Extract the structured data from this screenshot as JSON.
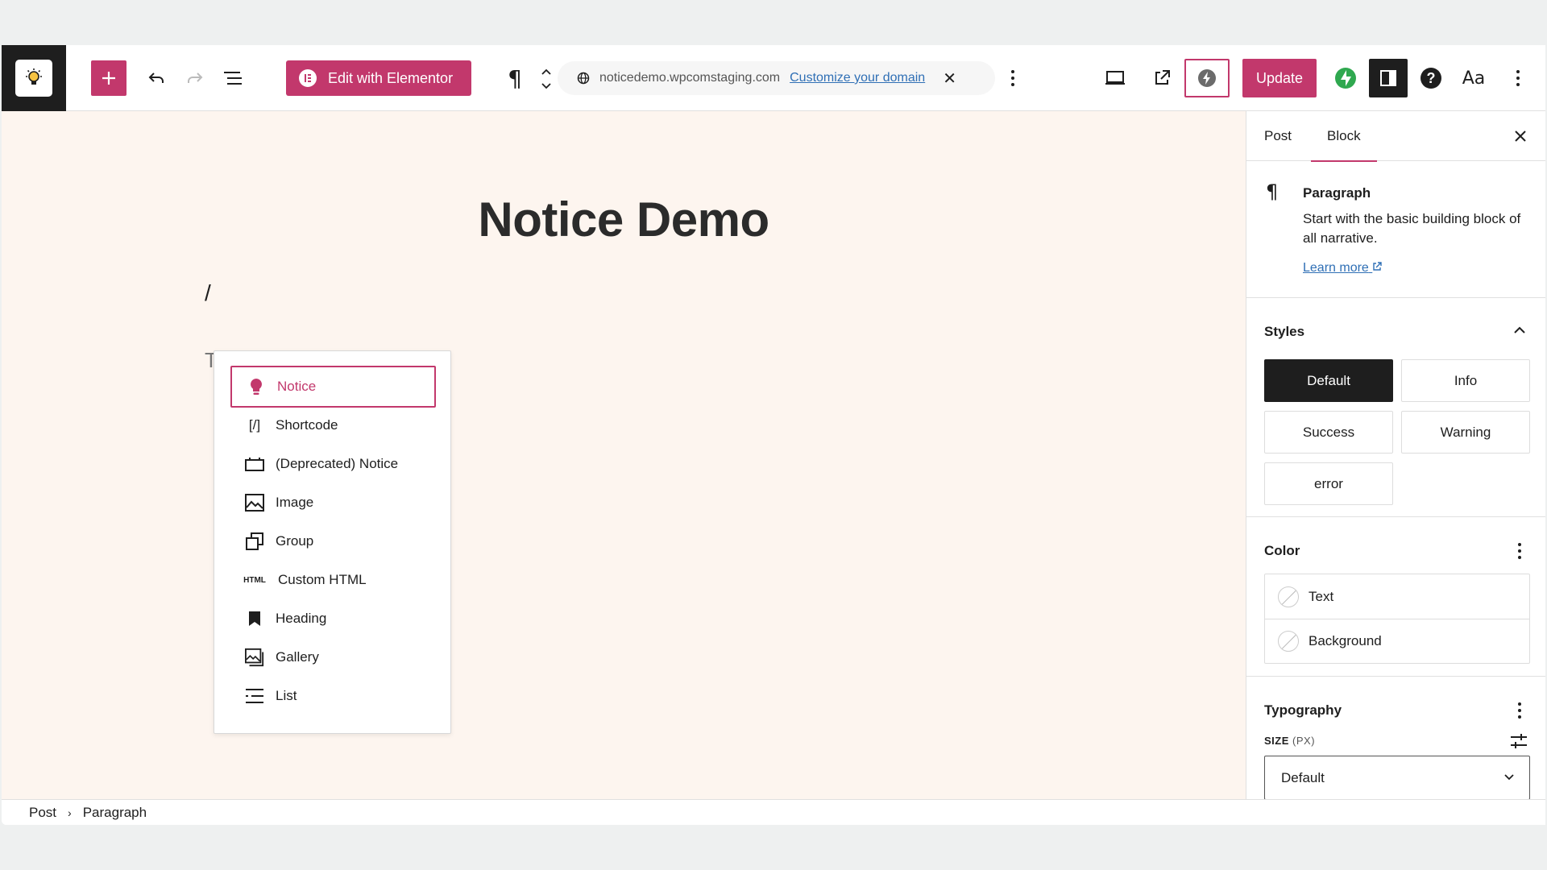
{
  "toolbar": {
    "elementor_label": "Edit with Elementor",
    "url_domain": "noticedemo.wpcomstaging.com",
    "url_link": "Customize your domain",
    "update_label": "Update",
    "styles_label": "Aa",
    "accent_color": "#c2386c"
  },
  "canvas": {
    "post_title": "Notice Demo",
    "slash": "/",
    "placeholder_fragment": "T"
  },
  "inserter": {
    "items": [
      {
        "label": "Notice",
        "icon": "lightbulb-icon",
        "selected": true
      },
      {
        "label": "Shortcode",
        "icon": "shortcode-icon",
        "icon_text": "[/]"
      },
      {
        "label": "(Deprecated) Notice",
        "icon": "deprecated-notice-icon"
      },
      {
        "label": "Image",
        "icon": "image-icon"
      },
      {
        "label": "Group",
        "icon": "group-icon"
      },
      {
        "label": "Custom HTML",
        "icon": "html-icon",
        "icon_text": "HTML"
      },
      {
        "label": "Heading",
        "icon": "bookmark-icon"
      },
      {
        "label": "Gallery",
        "icon": "gallery-icon"
      },
      {
        "label": "List",
        "icon": "list-icon"
      }
    ]
  },
  "sidebar": {
    "tabs": {
      "post": "Post",
      "block": "Block"
    },
    "block_card": {
      "title": "Paragraph",
      "description": "Start with the basic building block of all narrative.",
      "learn_more": "Learn more"
    },
    "styles": {
      "title": "Styles",
      "options": [
        "Default",
        "Info",
        "Success",
        "Warning",
        "error"
      ],
      "active": "Default"
    },
    "color": {
      "title": "Color",
      "items": [
        "Text",
        "Background"
      ]
    },
    "typography": {
      "title": "Typography",
      "size_label": "SIZE",
      "size_unit": "(PX)",
      "size_value": "Default"
    }
  },
  "footer": {
    "crumbs": [
      "Post",
      "Paragraph"
    ]
  }
}
